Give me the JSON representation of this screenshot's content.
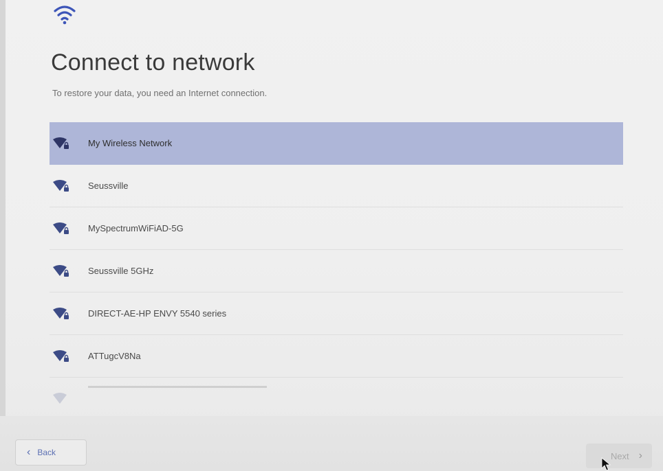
{
  "header": {
    "icon": "wifi-icon",
    "title": "Connect to network",
    "subtitle": "To restore your data, you need an Internet connection."
  },
  "networks": [
    {
      "name": "My Wireless Network",
      "selected": true,
      "secured": true
    },
    {
      "name": "Seussville",
      "selected": false,
      "secured": true
    },
    {
      "name": "MySpectrumWiFiAD-5G",
      "selected": false,
      "secured": true
    },
    {
      "name": "Seussville 5GHz",
      "selected": false,
      "secured": true
    },
    {
      "name": "DIRECT-AE-HP ENVY 5540 series",
      "selected": false,
      "secured": true
    },
    {
      "name": "ATTugcV8Na",
      "selected": false,
      "secured": true
    }
  ],
  "footer": {
    "back_label": "Back",
    "next_label": "Next"
  },
  "colors": {
    "selected_row": "#aeb6d8",
    "accent": "#5b6fb3",
    "wifi_icon": "#3c4b86"
  }
}
